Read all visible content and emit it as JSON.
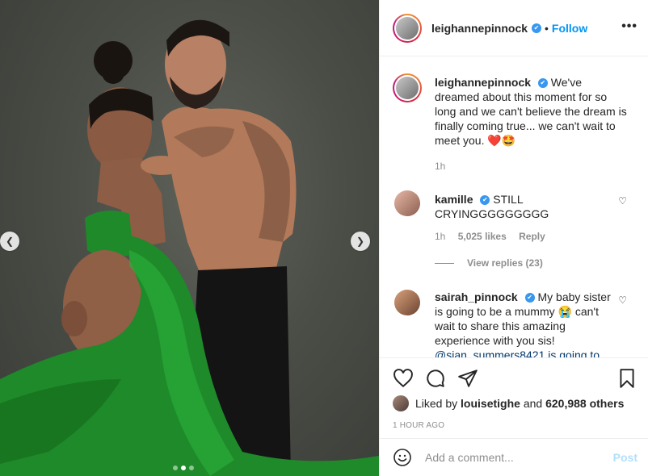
{
  "post": {
    "author": "leighannepinnock",
    "verified": "✔",
    "follow_label": "Follow",
    "separator": "•",
    "more_icon": "more-options-icon",
    "carousel": {
      "slide_count": 3,
      "active_index": 1
    }
  },
  "caption": {
    "username": "leighannepinnock",
    "text": "We've dreamed about this moment for so long and we can't believe the dream is finally coming true... we can't wait to meet you.",
    "emojis": "❤️🤩",
    "time": "1h"
  },
  "comments": [
    {
      "username": "kamille",
      "text": "STILL CRYINGGGGGGGGG",
      "time": "1h",
      "likes": "5,025 likes",
      "reply_label": "Reply",
      "view_replies": "View replies (23)"
    },
    {
      "username": "sairah_pinnock",
      "text": "My baby sister is going to be a mummy 😭 can't wait to share this amazing experience with you sis!",
      "mention": "@sian_summers8421 is going to"
    }
  ],
  "actions": {
    "liked_by_prefix": "Liked by",
    "liked_by_user": "louisetighe",
    "and_label": "and",
    "others": "620,988 others",
    "time_ago": "1 HOUR AGO"
  },
  "composer": {
    "placeholder": "Add a comment...",
    "post_label": "Post"
  },
  "colors": {
    "accent": "#0095f6",
    "verified": "#3897f0",
    "muted": "#8e8e8e",
    "post_disabled": "#b2dffc",
    "dress_green": "#1e8a2a"
  }
}
